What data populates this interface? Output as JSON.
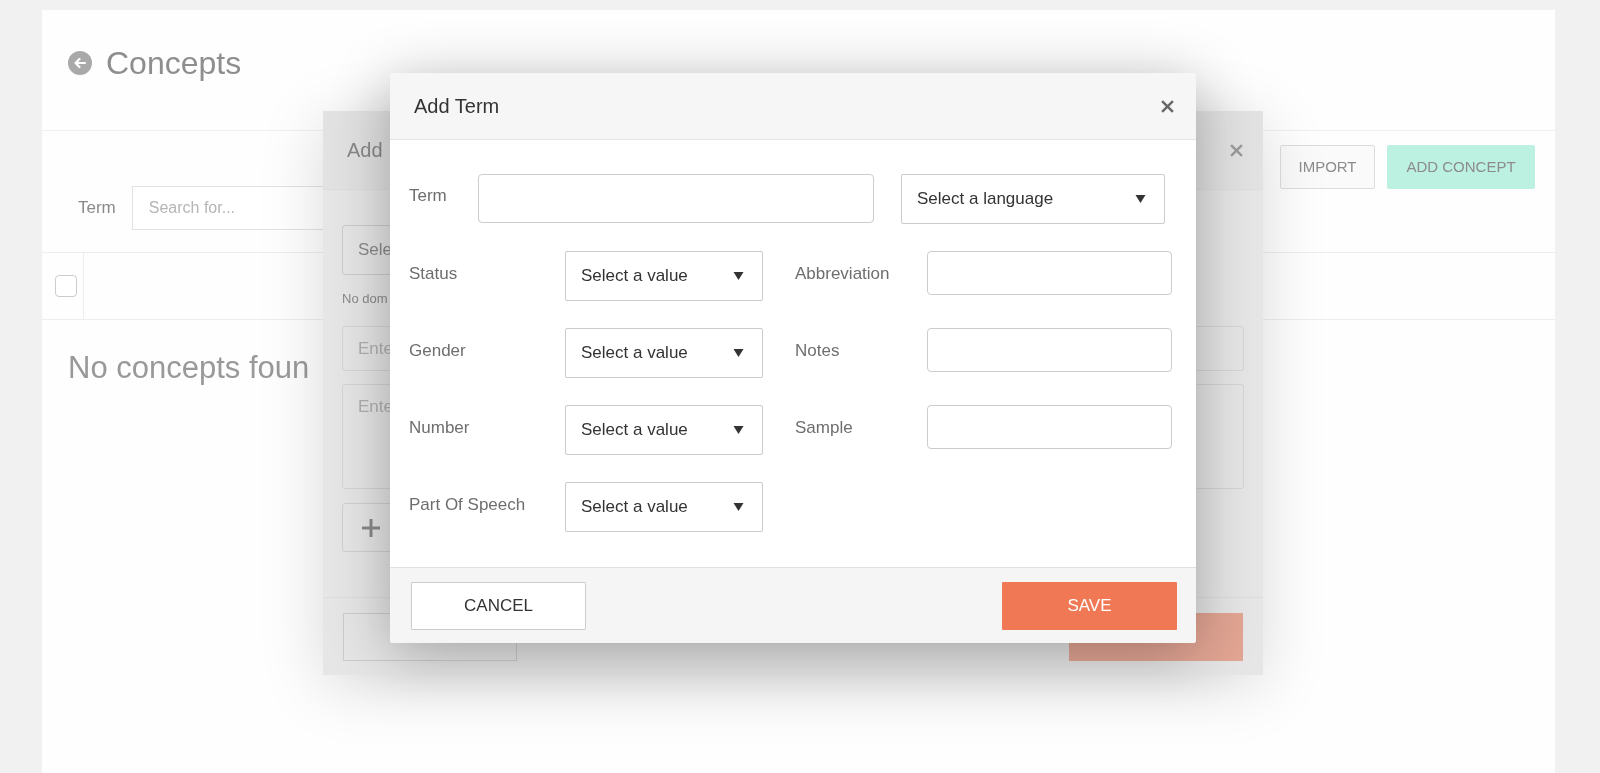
{
  "page": {
    "title": "Concepts",
    "filter": {
      "label": "Term",
      "placeholder": "Search for..."
    },
    "toolbar": [
      {
        "label": "IMPORT",
        "kind": "outline"
      },
      {
        "label": "ADD CONCEPT",
        "kind": "primary"
      }
    ],
    "table": {
      "select_all": {
        "checked": false
      }
    },
    "empty_message": "No concepts foun"
  },
  "background_dialog": {
    "title": "Add",
    "select_value": "Sele",
    "hint": "No dom",
    "input_placeholder": "Ente",
    "textarea_placeholder": "Ente"
  },
  "dialog": {
    "title": "Add Term",
    "term": {
      "label": "Term"
    },
    "language": {
      "placeholder": "Select a language"
    },
    "left_fields": [
      {
        "label": "Status",
        "placeholder": "Select a value"
      },
      {
        "label": "Gender",
        "placeholder": "Select a value"
      },
      {
        "label": "Number",
        "placeholder": "Select a value"
      },
      {
        "label": "Part Of Speech",
        "placeholder": "Select a value"
      }
    ],
    "right_fields": [
      {
        "label": "Abbreviation"
      },
      {
        "label": "Notes"
      },
      {
        "label": "Sample"
      }
    ],
    "buttons": [
      {
        "label": "CANCEL",
        "kind": "secondary"
      },
      {
        "label": "SAVE",
        "kind": "primary"
      }
    ]
  }
}
